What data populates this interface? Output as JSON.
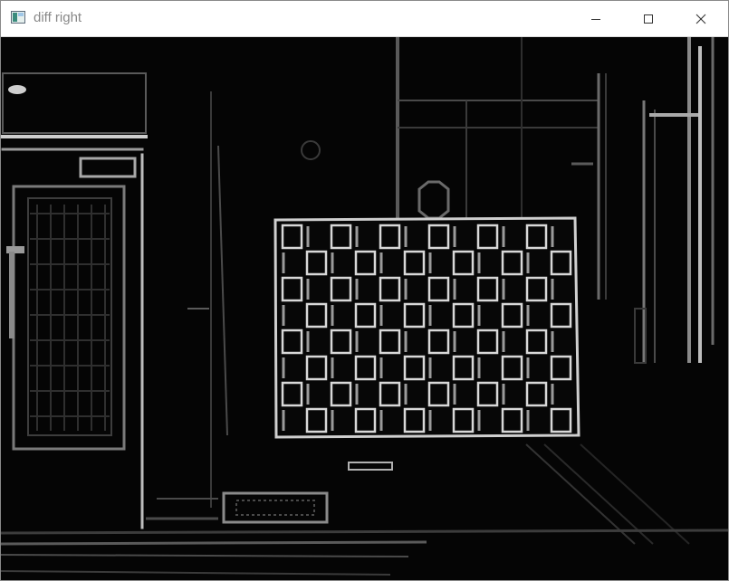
{
  "window": {
    "title": "diff right",
    "icons": {
      "app": "opencv-window-icon",
      "minimize": "minimize-icon",
      "maximize": "maximize-icon",
      "close": "close-icon"
    }
  },
  "image": {
    "description_name": "edge-difference-image",
    "background_color": "#050505",
    "edge_color": "#d8d8d8",
    "checkerboard": {
      "rows": 8,
      "cols": 12
    }
  }
}
